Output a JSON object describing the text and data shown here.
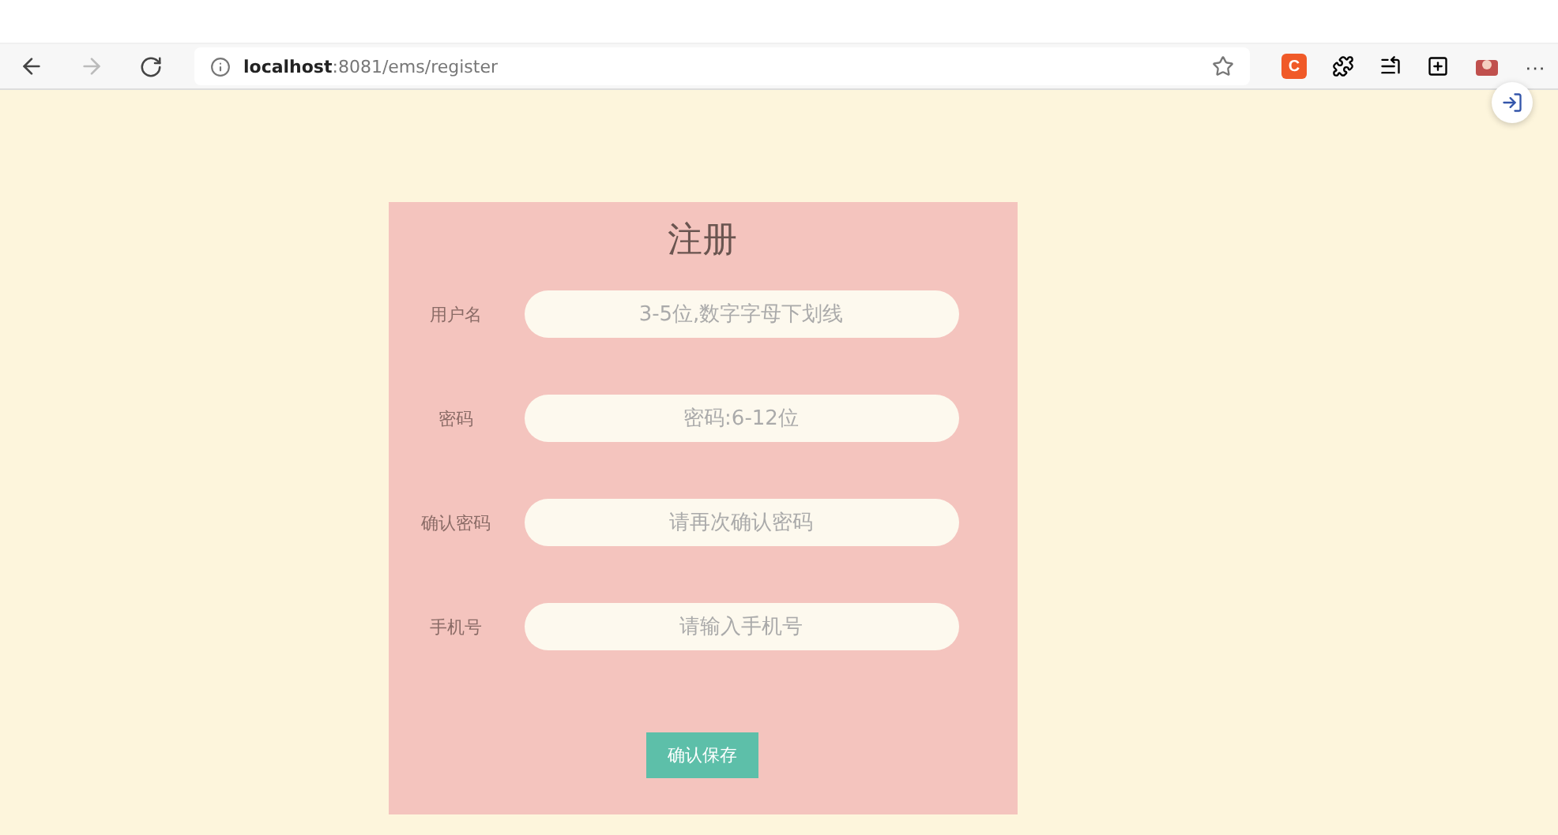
{
  "browser": {
    "address": "**localhost**:8081/ems/register",
    "extension_badge": "C",
    "more_menu": "···"
  },
  "form": {
    "title": "注册",
    "fields": [
      {
        "label": "用户名",
        "placeholder": "3-5位,数字字母下划线"
      },
      {
        "label": "密码",
        "placeholder": "密码:6-12位"
      },
      {
        "label": "确认密码",
        "placeholder": "请再次确认密码"
      },
      {
        "label": "手机号",
        "placeholder": "请输入手机号"
      }
    ],
    "submit": "确认保存"
  }
}
